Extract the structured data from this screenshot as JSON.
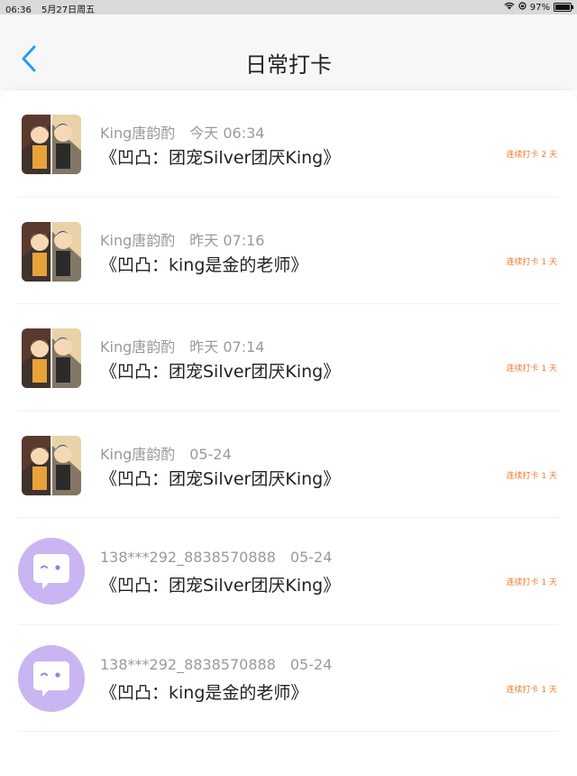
{
  "status_bar": {
    "time": "06:36",
    "date": "5月27日周五",
    "battery": "97%",
    "battery_level": 0.97
  },
  "header": {
    "title": "日常打卡",
    "back_icon": "chevron-left-icon"
  },
  "colors": {
    "accent": "#2d9cf0",
    "badge": "#f07a2a",
    "meta": "#9a9a9a",
    "avatar_purple": "#c9b5f2"
  },
  "feed": [
    {
      "user": "King唐韵酌",
      "time": "今天 06:34",
      "content": "《凹凸：团宠Silver团厌King》",
      "badge": "连续打卡 2 天",
      "avatar": "anime-avatar"
    },
    {
      "user": "King唐韵酌",
      "time": "昨天 07:16",
      "content": "《凹凸：king是金的老师》",
      "badge": "连续打卡 1 天",
      "avatar": "anime-avatar"
    },
    {
      "user": "King唐韵酌",
      "time": "昨天 07:14",
      "content": "《凹凸：团宠Silver团厌King》",
      "badge": "连续打卡 1 天",
      "avatar": "anime-avatar"
    },
    {
      "user": "King唐韵酌",
      "time": "05-24",
      "content": "《凹凸：团宠Silver团厌King》",
      "badge": "连续打卡 1 天",
      "avatar": "anime-avatar"
    },
    {
      "user": "138***292_8838570888",
      "time": "05-24",
      "content": "《凹凸：团宠Silver团厌King》",
      "badge": "连续打卡 1 天",
      "avatar": "chat-bubble-avatar"
    },
    {
      "user": "138***292_8838570888",
      "time": "05-24",
      "content": "《凹凸：king是金的老师》",
      "badge": "连续打卡 1 天",
      "avatar": "chat-bubble-avatar"
    }
  ]
}
